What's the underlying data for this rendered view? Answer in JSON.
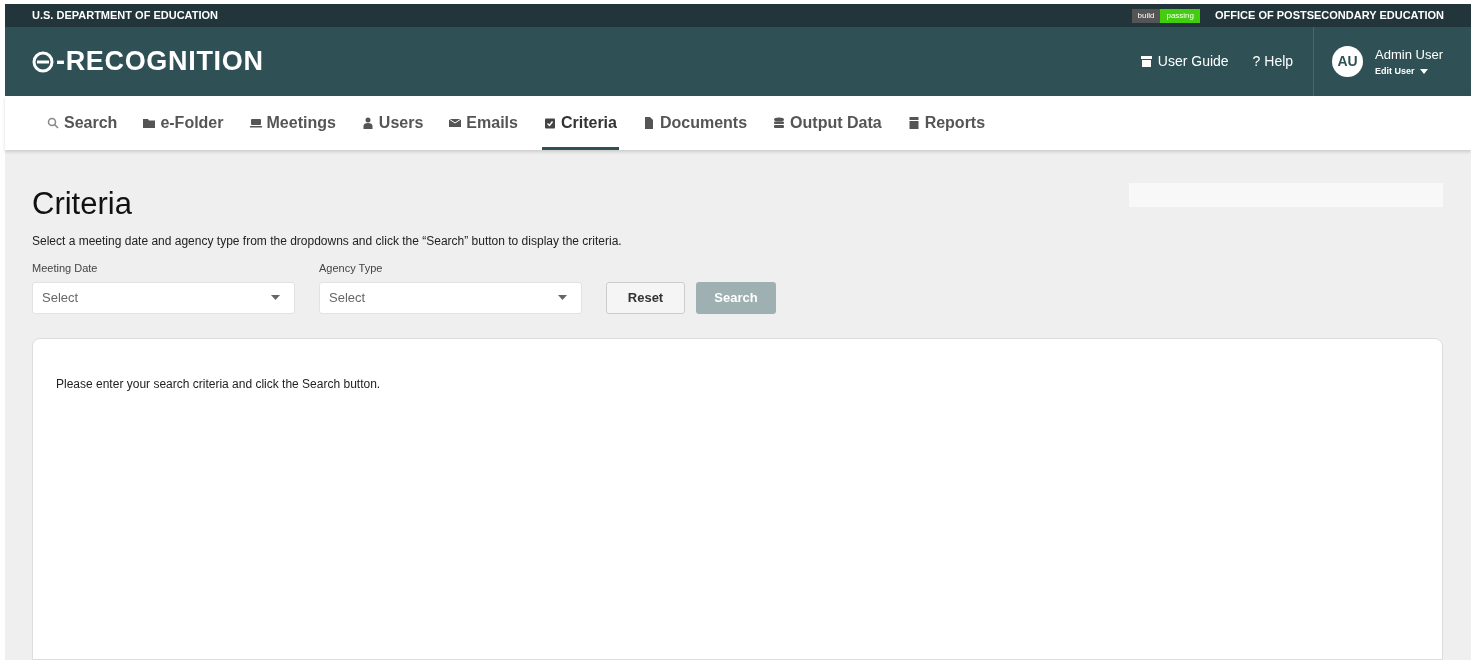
{
  "top_bar": {
    "agency": "U.S. DEPARTMENT OF EDUCATION",
    "badge_label": "build",
    "badge_status": "passing",
    "office": "OFFICE OF POSTSECONDARY EDUCATION"
  },
  "header": {
    "logo": "-RECOGNITION",
    "links": [
      "User Guide",
      "? Help"
    ],
    "user": {
      "initials": "AU",
      "name": "Admin User",
      "menu": "Edit User"
    }
  },
  "tabs": [
    {
      "label": "Search",
      "selected": false
    },
    {
      "label": "e-Folder",
      "selected": false
    },
    {
      "label": "Meetings",
      "selected": false
    },
    {
      "label": "Users",
      "selected": false
    },
    {
      "label": "Emails",
      "selected": false
    },
    {
      "label": "Criteria",
      "selected": true
    },
    {
      "label": "Documents",
      "selected": false
    },
    {
      "label": "Output Data",
      "selected": false
    },
    {
      "label": "Reports",
      "selected": false
    }
  ],
  "page": {
    "title": "Criteria",
    "instructions": "Select a meeting date and agency type from the dropdowns and click the “Search” button to display the criteria.",
    "fields": [
      {
        "label": "Meeting Date",
        "placeholder": "Select"
      },
      {
        "label": "Agency Type",
        "placeholder": "Select"
      }
    ],
    "buttons": [
      {
        "label": "Reset",
        "disabled": false
      },
      {
        "label": "Search",
        "disabled": true
      }
    ],
    "message": "Please enter your search criteria and click the Search button."
  }
}
